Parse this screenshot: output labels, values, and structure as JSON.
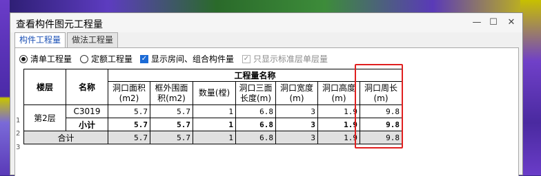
{
  "window": {
    "title": "查看构件图元工程量",
    "minimize_glyph": "—",
    "maximize_glyph": "☐",
    "close_glyph": "✕"
  },
  "tabs": [
    {
      "label": "构件工程量",
      "active": true
    },
    {
      "label": "做法工程量",
      "active": false
    }
  ],
  "options": {
    "radio_bill": "清单工程量",
    "radio_quota": "定额工程量",
    "check_rooms": "显示房间、组合构件量",
    "check_standard": "只显示标准层单层量"
  },
  "table": {
    "col_floor": "楼层",
    "col_name": "名称",
    "group_header": "工程量名称",
    "metric_headers": [
      "洞口面积(m2)",
      "框外围面积(m2)",
      "数量(樘)",
      "洞口三面长度(m)",
      "洞口宽度(m)",
      "洞口高度(m)",
      "洞口周长(m)"
    ],
    "row_numbers": [
      "1",
      "2",
      "3"
    ],
    "floor_value": "第2层",
    "rows": [
      {
        "name": "C3019",
        "values": [
          "5.7",
          "5.7",
          "1",
          "6.8",
          "3",
          "1.9",
          "9.8"
        ]
      },
      {
        "name": "小计",
        "values": [
          "5.7",
          "5.7",
          "1",
          "6.8",
          "3",
          "1.9",
          "9.8"
        ]
      }
    ],
    "total": {
      "label": "合计",
      "values": [
        "5.7",
        "5.7",
        "1",
        "6.8",
        "3",
        "1.9",
        "9.8"
      ]
    }
  },
  "colors": {
    "highlight_box": "#e01f1f",
    "active_tab_text": "#1a4fb5",
    "checkbox_fill": "#1c6bd6",
    "total_row_bg": "#e0e0e0"
  }
}
